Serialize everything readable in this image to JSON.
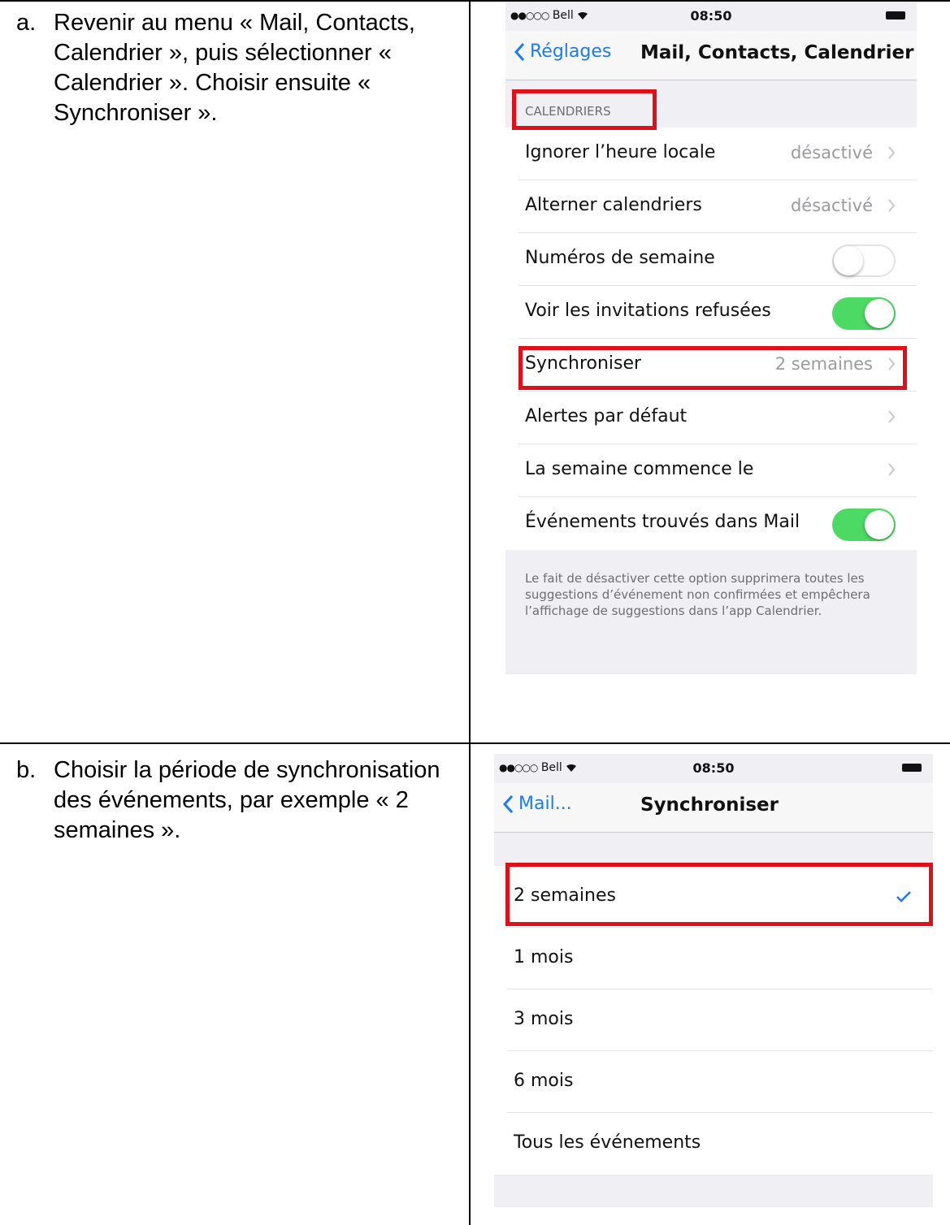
{
  "step_a": {
    "marker": "a.",
    "text": "Revenir au menu « Mail, Contacts, Calendrier », puis sélectionner « Calendrier ». Choisir ensuite « Synchroniser »."
  },
  "step_b": {
    "marker": "b.",
    "text": "Choisir la période de synchronisation des événements, par exemple « 2 semaines »."
  },
  "screen_a": {
    "status": {
      "carrier": "Bell",
      "time": "08:50"
    },
    "back_label": "Réglages",
    "title": "Mail, Contacts, Calendrier",
    "section_header": "CALENDRIERS",
    "rows": [
      {
        "label": "Ignorer l’heure locale",
        "value": "désactivé"
      },
      {
        "label": "Alterner calendriers",
        "value": "désactivé"
      },
      {
        "label": "Numéros de semaine",
        "toggle": "off"
      },
      {
        "label": "Voir les invitations refusées",
        "toggle": "on"
      },
      {
        "label": "Synchroniser",
        "value": "2 semaines"
      },
      {
        "label": "Alertes par défaut"
      },
      {
        "label": "La semaine commence le"
      },
      {
        "label": "Événements trouvés dans Mail",
        "toggle": "on"
      }
    ],
    "footnote": "Le fait de désactiver cette option supprimera toutes les suggestions d’événement non confirmées et empêchera l’affichage de suggestions dans l’app Calendrier."
  },
  "screen_b": {
    "status": {
      "carrier": "Bell",
      "time": "08:50"
    },
    "back_label": "Mail...",
    "title": "Synchroniser",
    "options": [
      {
        "label": "2 semaines",
        "selected": true
      },
      {
        "label": "1 mois"
      },
      {
        "label": "3 mois"
      },
      {
        "label": "6 mois"
      },
      {
        "label": "Tous les événements"
      }
    ]
  },
  "colors": {
    "ios_blue": "#1a7cf0",
    "toggle_green": "#4cd964",
    "highlight_red": "#e0101a"
  },
  "icons": [
    "chevron-left-icon",
    "chevron-right-icon",
    "checkmark-icon",
    "wifi-icon",
    "battery-icon"
  ]
}
